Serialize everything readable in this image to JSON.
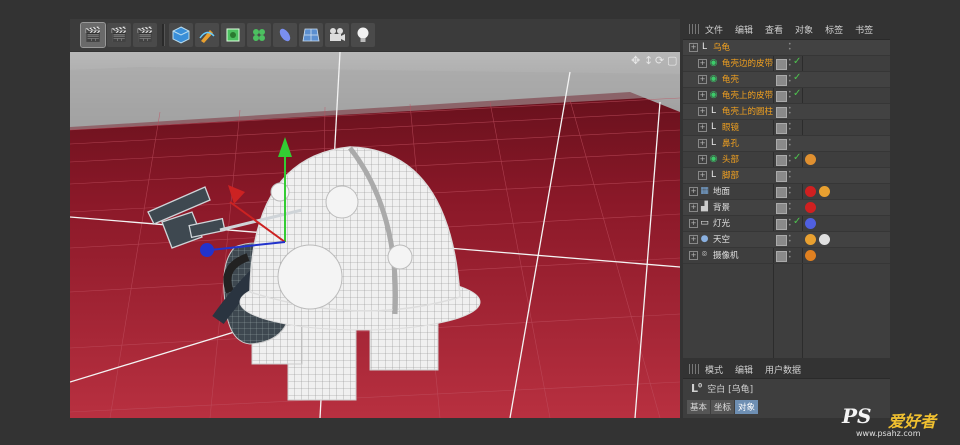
{
  "toolbar": {
    "buttons": [
      {
        "name": "render-view-button",
        "icon": "clapper-icon",
        "active": true
      },
      {
        "name": "render-picture-viewer-button",
        "icon": "clapper-play-icon",
        "active": false
      },
      {
        "name": "render-settings-button",
        "icon": "clapper-gear-icon",
        "active": false
      },
      {
        "name": "cube-primitive-button",
        "icon": "cube-icon",
        "active": false
      },
      {
        "name": "pen-spline-button",
        "icon": "pen-icon",
        "active": false
      },
      {
        "name": "subdivision-button",
        "icon": "nurbs-icon",
        "active": false
      },
      {
        "name": "cloner-button",
        "icon": "cloner-icon",
        "active": false
      },
      {
        "name": "deformer-button",
        "icon": "bend-icon",
        "active": false
      },
      {
        "name": "floor-button",
        "icon": "floor-icon",
        "active": false
      },
      {
        "name": "camera-button",
        "icon": "camera-icon",
        "active": false
      },
      {
        "name": "light-button",
        "icon": "lightbulb-icon",
        "active": false
      }
    ]
  },
  "object_manager": {
    "menu": [
      "文件",
      "编辑",
      "查看",
      "对象",
      "标签",
      "书签"
    ],
    "rows": [
      {
        "label": "乌龟",
        "color": "orange",
        "indent": 0,
        "icon": "null",
        "vis": false,
        "check": false,
        "tag": ""
      },
      {
        "label": "龟壳边的皮带",
        "color": "orange",
        "indent": 1,
        "icon": "sds",
        "vis": true,
        "check": true,
        "tag": ""
      },
      {
        "label": "龟壳",
        "color": "orange",
        "indent": 1,
        "icon": "sds",
        "vis": true,
        "check": true,
        "tag": ""
      },
      {
        "label": "龟壳上的皮带",
        "color": "orange",
        "indent": 1,
        "icon": "sds",
        "vis": true,
        "check": true,
        "tag": ""
      },
      {
        "label": "龟壳上的圆柱",
        "color": "orange",
        "indent": 1,
        "icon": "null",
        "vis": true,
        "check": false,
        "tag": ""
      },
      {
        "label": "眼镜",
        "color": "orange",
        "indent": 1,
        "icon": "null",
        "vis": true,
        "check": false,
        "tag": ""
      },
      {
        "label": "鼻孔",
        "color": "orange",
        "indent": 1,
        "icon": "null",
        "vis": true,
        "check": false,
        "tag": ""
      },
      {
        "label": "头部",
        "color": "orange",
        "indent": 1,
        "icon": "sds",
        "vis": true,
        "check": true,
        "tag": "orange-dots"
      },
      {
        "label": "脚部",
        "color": "orange",
        "indent": 1,
        "icon": "null",
        "vis": true,
        "check": false,
        "tag": ""
      },
      {
        "label": "地面",
        "color": "white",
        "indent": 0,
        "icon": "floor",
        "vis": true,
        "check": false,
        "tag": "red-ball-clapper"
      },
      {
        "label": "背景",
        "color": "white",
        "indent": 0,
        "icon": "background",
        "vis": true,
        "check": false,
        "tag": "red-ball"
      },
      {
        "label": "灯光",
        "color": "white",
        "indent": 0,
        "icon": "light",
        "vis": true,
        "check": true,
        "tag": "target"
      },
      {
        "label": "天空",
        "color": "white",
        "indent": 0,
        "icon": "sky",
        "vis": true,
        "check": false,
        "tag": "clapper-sky"
      },
      {
        "label": "摄像机",
        "color": "white",
        "indent": 0,
        "icon": "camera",
        "vis": true,
        "check": false,
        "tag": "no-render"
      }
    ]
  },
  "attributes": {
    "menu": [
      "模式",
      "编辑",
      "用户数据"
    ],
    "title": "空白 [乌龟]",
    "tabs": [
      {
        "label": "基本",
        "selected": false
      },
      {
        "label": "坐标",
        "selected": false
      },
      {
        "label": "对象",
        "selected": true
      }
    ]
  },
  "watermark": {
    "main": "PS",
    "cn": "爱好者",
    "url": "www.psahz.com"
  },
  "colors": {
    "orange_label": "#f0a020",
    "floor_red": "#8a1020",
    "panel_bg": "#3e3e3e",
    "check_green": "#4ec24e"
  }
}
